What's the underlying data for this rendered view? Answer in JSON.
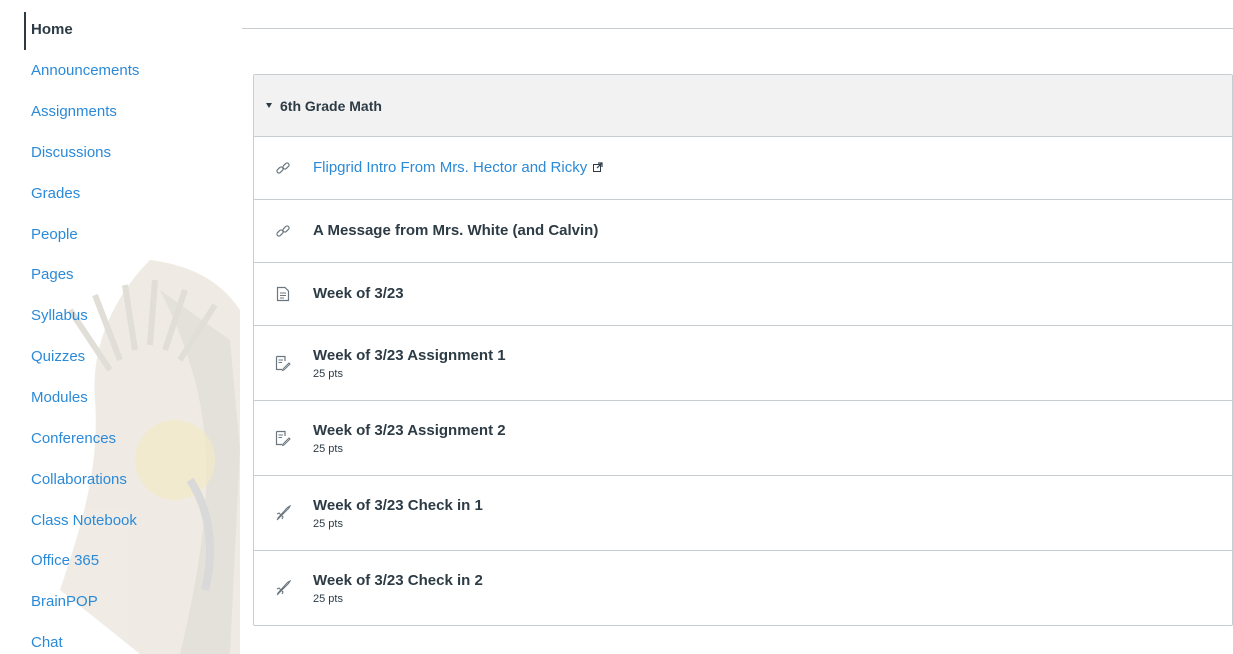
{
  "nav": {
    "items": [
      {
        "label": "Home",
        "active": true
      },
      {
        "label": "Announcements"
      },
      {
        "label": "Assignments"
      },
      {
        "label": "Discussions"
      },
      {
        "label": "Grades"
      },
      {
        "label": "People"
      },
      {
        "label": "Pages"
      },
      {
        "label": "Syllabus"
      },
      {
        "label": "Quizzes"
      },
      {
        "label": "Modules"
      },
      {
        "label": "Conferences"
      },
      {
        "label": "Collaborations"
      },
      {
        "label": "Class Notebook"
      },
      {
        "label": "Office 365"
      },
      {
        "label": "BrainPOP"
      },
      {
        "label": "Chat"
      }
    ]
  },
  "module": {
    "title": "6th Grade Math",
    "items": [
      {
        "title": "Flipgrid Intro From Mrs. Hector and Ricky",
        "icon": "link-icon",
        "external": true
      },
      {
        "title": "A Message from Mrs. White (and Calvin)",
        "icon": "link-icon"
      },
      {
        "title": "Week of 3/23",
        "icon": "page-icon"
      },
      {
        "title": "Week of 3/23 Assignment 1",
        "points": "25 pts",
        "icon": "assignment-icon"
      },
      {
        "title": "Week of 3/23 Assignment 2",
        "points": "25 pts",
        "icon": "assignment-icon"
      },
      {
        "title": "Week of 3/23 Check in 1",
        "points": "25 pts",
        "icon": "quiz-icon"
      },
      {
        "title": "Week of 3/23 Check in 2",
        "points": "25 pts",
        "icon": "quiz-icon"
      }
    ]
  },
  "colors": {
    "link": "#2b8ad8",
    "text": "#2d3b45",
    "border": "#c7cdd1",
    "header_bg": "#f2f2f2"
  }
}
